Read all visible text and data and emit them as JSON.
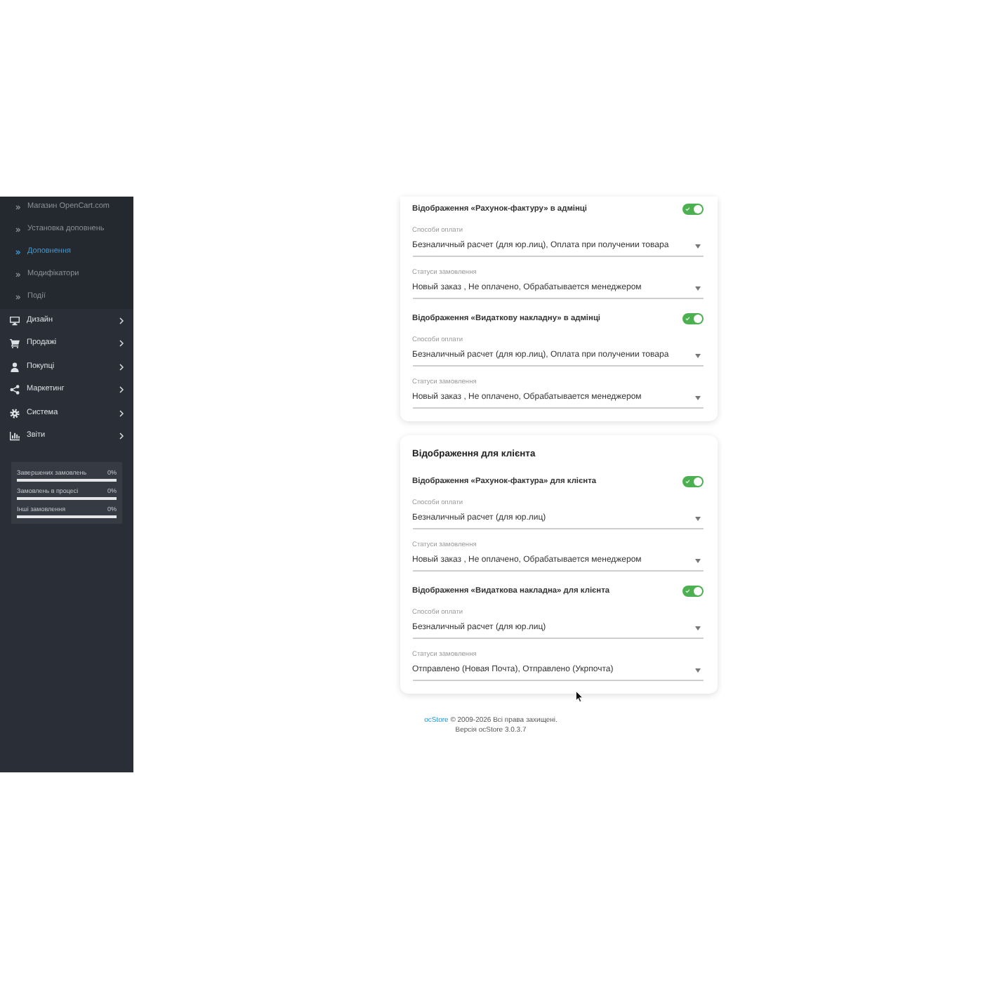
{
  "sidebar": {
    "items": [
      {
        "label": "Магазин OpenCart.com",
        "kind": "subitem",
        "selected": false
      },
      {
        "label": "Установка доповнень",
        "kind": "subitem",
        "selected": false
      },
      {
        "label": "Доповнення",
        "kind": "subitem",
        "selected": true
      },
      {
        "label": "Модифікатори",
        "kind": "subitem",
        "selected": false
      },
      {
        "label": "Події",
        "kind": "subitem",
        "selected": false
      },
      {
        "label": "Дизайн",
        "kind": "menu",
        "selected": false
      },
      {
        "label": "Продажі",
        "kind": "menu",
        "selected": false
      },
      {
        "label": "Покупці",
        "kind": "menu",
        "selected": false
      },
      {
        "label": "Маркетинг",
        "kind": "menu",
        "selected": false
      },
      {
        "label": "Система",
        "kind": "menu",
        "selected": false
      },
      {
        "label": "Звіти",
        "kind": "menu",
        "selected": false
      }
    ],
    "stats": [
      {
        "label": "Завершених замовлень",
        "reading": "0%",
        "level": 0
      },
      {
        "label": "Замовлень в процесі",
        "reading": "0%",
        "level": 0
      },
      {
        "label": "Інші замовлення",
        "reading": "0%",
        "level": 0
      }
    ]
  },
  "main": {
    "cards": [
      {
        "sections": [
          {
            "label": "Відображення «Рахунок-фактуру» в адмінці",
            "on": true,
            "fields": [
              {
                "label": "Способи оплати",
                "value": "Безналичный расчет (для юр.лиц), Оплата при получении товара"
              },
              {
                "label": "Статуси замовлення",
                "value": "Новый заказ , Не оплачено, Обрабатывается менеджером"
              }
            ]
          },
          {
            "label": "Відображення «Видаткову накладну» в адмінці",
            "on": true,
            "fields": [
              {
                "label": "Способи оплати",
                "value": "Безналичный расчет (для юр.лиц), Оплата при получении товара"
              },
              {
                "label": "Статуси замовлення",
                "value": "Новый заказ , Не оплачено, Обрабатывается менеджером"
              }
            ]
          }
        ]
      },
      {
        "heading": "Відображення для клієнта",
        "sections": [
          {
            "label": "Відображення «Рахунок-фактура» для клієнта",
            "on": true,
            "fields": [
              {
                "label": "Способи оплати",
                "value": "Безналичный расчет (для юр.лиц)"
              },
              {
                "label": "Статуси замовлення",
                "value": "Новый заказ , Не оплачено, Обрабатывается менеджером"
              }
            ]
          },
          {
            "label": "Відображення «Видаткова накладна» для клієнта",
            "on": true,
            "fields": [
              {
                "label": "Способи оплати",
                "value": "Безналичный расчет (для юр.лиц)"
              },
              {
                "label": "Статуси замовлення",
                "value": "Отправлено (Новая Почта), Отправлено (Укрпочта)"
              }
            ]
          }
        ]
      }
    ]
  },
  "footer": {
    "link": "ocStore",
    "text": "© 2009-2026 Всі права захищені.",
    "version": "Версія ocStore 3.0.3.7"
  }
}
